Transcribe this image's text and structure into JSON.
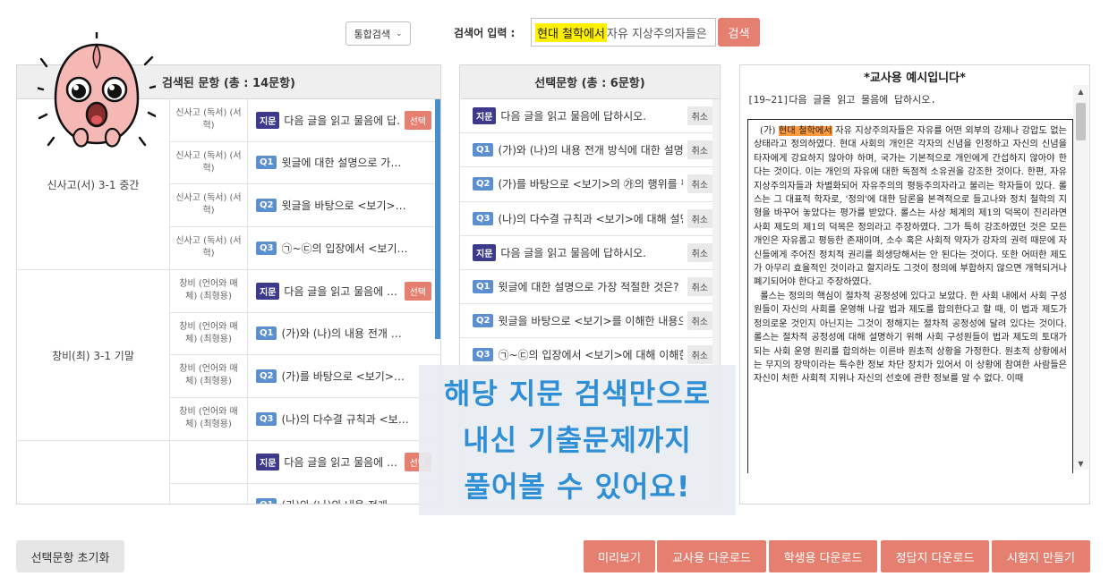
{
  "search": {
    "type_label": "통합검색",
    "label": "검색어 입력 :",
    "query_highlight": "현대 철학에서",
    "query_rest": " 자유 지상주의자들은",
    "button": "검색"
  },
  "results": {
    "title": "검색된 문항 (총 : 14문항)",
    "groups": [
      {
        "name": "신사고(서) 3-1 중간",
        "rows": [
          {
            "source": "신사고 (독서) (서혁)",
            "badge": "지문",
            "text": "다음 글을 읽고 물음에 답…",
            "pick": "선택"
          },
          {
            "source": "신사고 (독서) (서혁)",
            "badge": "Q1",
            "text": "윗글에 대한 설명으로 가…",
            "pick": ""
          },
          {
            "source": "신사고 (독서) (서혁)",
            "badge": "Q2",
            "text": "윗글을 바탕으로 <보기>…",
            "pick": ""
          },
          {
            "source": "신사고 (독서) (서혁)",
            "badge": "Q3",
            "text": "㉠~㉢의 입장에서 <보기…",
            "pick": ""
          }
        ]
      },
      {
        "name": "창비(최) 3-1 기말",
        "rows": [
          {
            "source": "창비 (언어와 매체) (최형용)",
            "badge": "지문",
            "text": "다음 글을 읽고 물음에 …",
            "pick": "선택"
          },
          {
            "source": "창비 (언어와 매체) (최형용)",
            "badge": "Q1",
            "text": "(가)와 (나)의 내용 전개 …",
            "pick": ""
          },
          {
            "source": "창비 (언어와 매체) (최형용)",
            "badge": "Q2",
            "text": "(가)를 바탕으로 <보기>…",
            "pick": ""
          },
          {
            "source": "창비 (언어와 매체) (최형용)",
            "badge": "Q3",
            "text": "(나)의 다수결 규칙과 <보…",
            "pick": ""
          }
        ]
      },
      {
        "name": "",
        "rows": [
          {
            "source": "",
            "badge": "지문",
            "text": "다음 글을 읽고 물음에 …",
            "pick": "선택"
          },
          {
            "source": "",
            "badge": "Q1",
            "text": "(가)와 (나)의 내용 전개 …",
            "pick": ""
          }
        ]
      }
    ]
  },
  "selected": {
    "title": "선택문항 (총 : 6문항)",
    "remove_label": "취소",
    "items": [
      {
        "badge": "지문",
        "text": "다음 글을 읽고 물음에 답하시오."
      },
      {
        "badge": "Q1",
        "text": "(가)와 (나)의 내용 전개 방식에 대한 설명으로"
      },
      {
        "badge": "Q2",
        "text": "(가)를 바탕으로 <보기>의 ㉮의 행위를 평가할"
      },
      {
        "badge": "Q3",
        "text": "(나)의 다수결 규칙과 <보기>에 대해 설명한"
      },
      {
        "badge": "지문",
        "text": "다음 글을 읽고 물음에 답하시오."
      },
      {
        "badge": "Q1",
        "text": "윗글에 대한 설명으로 가장 적절한 것은?"
      },
      {
        "badge": "Q2",
        "text": "윗글을 바탕으로 <보기>를 이해한 내용으로"
      },
      {
        "badge": "Q3",
        "text": "㉠~㉢의 입장에서 <보기>에 대해 이해한 것"
      }
    ]
  },
  "preview": {
    "title": "*교사용 예시입니다*",
    "instruction": "[19~21]다음 글을 읽고 물음에 답하시오.",
    "passage_lead": "(가) ",
    "passage_highlight": "현대 철학에서",
    "passage_p1": " 자유 지상주의자들은 자유를 어떤 외부의 강제나 강압도 없는 상태라고 정의하였다. 현대 사회의 개인은 각자의 신념을 인정하고 자신의 신념을 타자에게 강요하지 않아야 하며, 국가는 기본적으로 개인에게 간섭하지 않아야 한다는 것이다. 이는 개인의 자유에 대한 독점적 소유권을 강조한 것이다. 한편, 자유 지상주의자들과 차별화되어 자유주의의 평등주의자라고 불리는 학자들이 있다. 롤스는 그 대표적 학자로, '정의'에 대한 담론을 본격적으로 들고나와 정치 철학의 지형을 바꾸어 놓았다는 평가를 받았다. 롤스는 사상 체계의 제1의 덕목이 진리라면 사회 제도의 제1의 덕목은 정의라고 주장하였다. 그가 특히 강조하였던 것은 모든 개인은 자유롭고 평등한 존재이며, 소수 혹은 사회적 약자가 강자의 권력 때문에 자신들에게 주어진 정치적 권리를 희생당해서는 안 된다는 것이다. 또한 어떠한 제도가 아무리 효율적인 것이라고 할지라도 그것이 정의에 부합하지 않으면 개혁되거나 폐기되어야 한다고 주장하였다.",
    "passage_p2": "롤스는 정의의 핵심이 절차적 공정성에 있다고 보았다. 한 사회 내에서 사회 구성원들이 자신의 사회를 운영해 나갈 법과 제도를 합의한다고 할 때, 이 법과 제도가 정의로운 것인지 아닌지는 그것이 정해지는 절차적 공정성에 달려 있다는 것이다. 롤스는 절차적 공정성에 대해 설명하기 위해 사회 구성원들이 법과 제도의 토대가 되는 사회 운영 원리를 합의하는 이른바 원초적 상황을 가정한다. 원초적 상황에서는 무지의 장막이라는 특수한 정보 차단 장치가 있어서 이 상황에 참여한 사람들은 자신이 처한 사회적 지위나 자신의 선호에 관한 정보를 알 수 없다. 이때"
  },
  "promo": {
    "line1": "해당 지문 검색만으로",
    "line2": "내신 기출문제까지",
    "line3": "풀어볼 수 있어요!"
  },
  "bottom": {
    "reset": "선택문항 초기화",
    "preview": "미리보기",
    "teacher_download": "교사용 다운로드",
    "student_download": "학생용 다운로드",
    "answer_download": "정답지 다운로드",
    "make_exam": "시험지 만들기"
  },
  "colors": {
    "accent": "#e57f70",
    "jimun_badge": "#3d3a8c",
    "question_badge": "#5b8fd0",
    "promo_text": "#2f8fd6",
    "highlight_yellow": "#ffef00",
    "highlight_orange": "#ff9a3c"
  }
}
